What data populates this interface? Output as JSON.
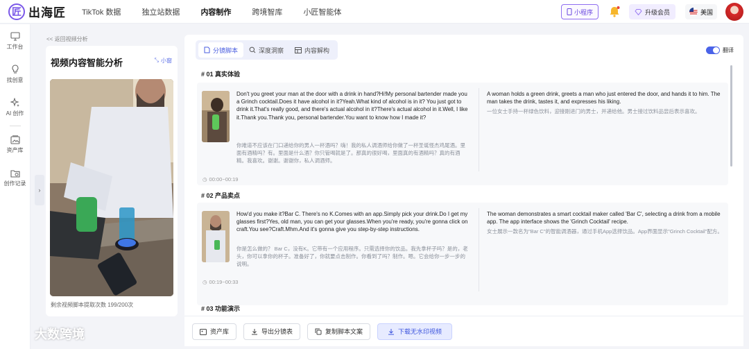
{
  "brand": {
    "logo_char": "匠",
    "name": "出海匠"
  },
  "nav": [
    "TikTok 数据",
    "独立站数据",
    "内容制作",
    "跨境智库",
    "小匠智能体"
  ],
  "topright": {
    "mini_program": "小程序",
    "upgrade": "升级会员",
    "region": "美国"
  },
  "sidebar": [
    "工作台",
    "找创意",
    "AI 创作",
    "资产库",
    "创作记录"
  ],
  "back_link": "<< 返回视频分析",
  "left_panel": {
    "title": "视频内容智能分析",
    "mini_label": "小窗",
    "remaining": "剩余视频脚本提取次数 199/200次"
  },
  "tabs": [
    "分镜脚本",
    "深度洞察",
    "内容解构"
  ],
  "translate_label": "翻译",
  "sections": [
    {
      "heading": "# 01 真实体验",
      "en": "Don't you greet your man at the door with a drink in hand?Hi!My personal bartender made you a Grinch cocktail.Does it have alcohol in it?Yeah.What kind of alcohol is in it? You just got to drink it.That's really good, and there's actual alcohol in it?There's actual alcohol in it.Well, I like it.Thank you.Thank you, personal bartender.You want to know how I made it?",
      "zh": "你难道不应该在门口递给你的男人一杯酒吗？嗨！我的私人调酒师给你做了一杯圣诞怪杰鸡尾酒。里面有酒精吗？有。里面是什么酒？你只管喝就是了。那真的很好喝，里面真的有酒精吗？真的有酒精。我喜欢。谢谢。谢谢你，私人调酒师。",
      "desc_en": "A woman holds a green drink, greets a man who just entered the door, and hands it to him. The man takes the drink, tastes it, and expresses his liking.",
      "desc_zh": "一位女士手持一杯绿色饮料，迎接刚进门的男士，并递给他。男士接过饮料品尝后表示喜欢。",
      "time": "00:00~00:19"
    },
    {
      "heading": "# 02 产品卖点",
      "en": "How'd you make it?Bar C. There's no K.Comes with an app.Simply pick your drink.Do I get my glasses first?Yes, old man, you can get your glasses.When you're ready, you're gonna click on craft.You see?Craft.Mhm.And it's gonna give you step-by-step instructions.",
      "zh": "你是怎么做的？ Bar C，没有K。它带有一个应用程序。只需选择你的饮品。我先拿杯子吗？是的，老头，你可以拿你的杯子。准备好了，你就要点击制作。你看到了吗？制作。嗯。它会给你一步一步的说明。",
      "desc_en": "The woman demonstrates a smart cocktail maker called 'Bar C', selecting a drink from a mobile app. The app interface shows the 'Grinch Cocktail' recipe.",
      "desc_zh": "女士展示一款名为\"Bar C\"的智能调酒器，通过手机App选择饮品。App界面显示\"Grinch Cocktail\"配方。",
      "time": "00:19~00:33"
    },
    {
      "heading": "# 03 功能演示"
    }
  ],
  "bottom_buttons": [
    "资产库",
    "导出分镜表",
    "复制脚本文案",
    "下载无水印视频"
  ],
  "watermark": "大数跨境",
  "colors": {
    "accent": "#4a5ee0",
    "brand_purple": "#7a57e8"
  }
}
